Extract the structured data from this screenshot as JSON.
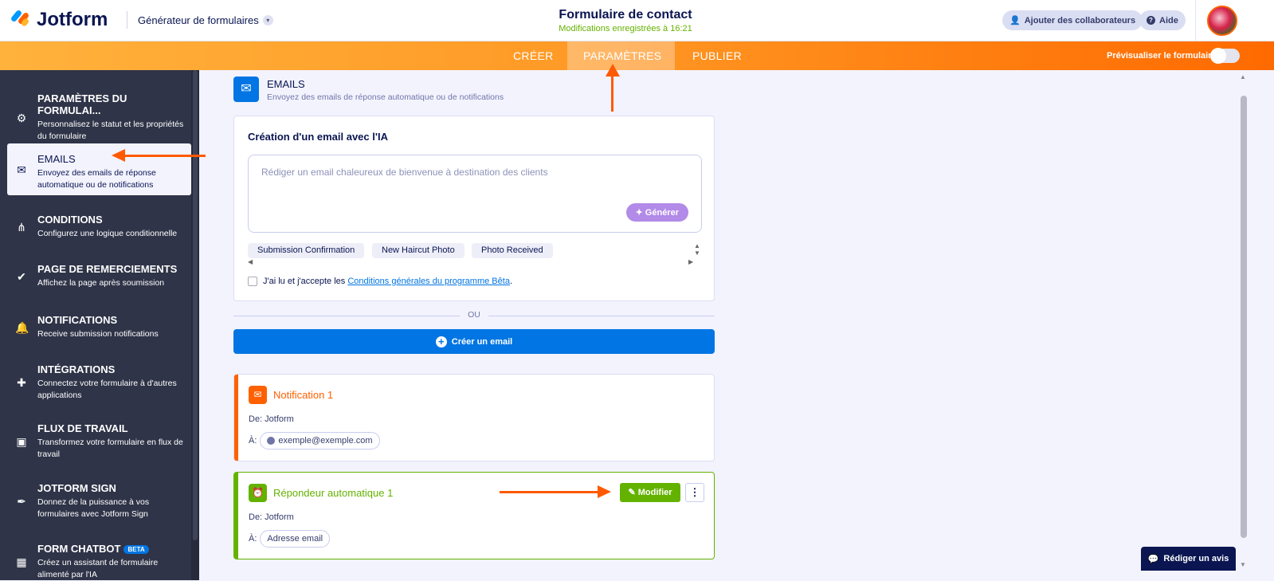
{
  "header": {
    "brand": "Jotform",
    "builder": "Générateur de formulaires",
    "form_title": "Formulaire de contact",
    "saved_status": "Modifications enregistrées à 16:21",
    "collab_label": "Ajouter des collaborateurs",
    "help_label": "Aide"
  },
  "nav": {
    "tabs": [
      {
        "label": "CRÉER"
      },
      {
        "label": "PARAMÈTRES"
      },
      {
        "label": "PUBLIER"
      }
    ],
    "preview_label": "Prévisualiser le formulaire",
    "preview_on": false
  },
  "sidebar": {
    "items": [
      {
        "title": "PARAMÈTRES DU FORMULAI...",
        "desc": "Personnalisez le statut et les propriétés du formulaire"
      },
      {
        "title": "EMAILS",
        "desc": "Envoyez des emails de réponse automatique ou de notifications"
      },
      {
        "title": "CONDITIONS",
        "desc": "Configurez une logique conditionnelle"
      },
      {
        "title": "PAGE DE REMERCIEMENTS",
        "desc": "Affichez la page après soumission"
      },
      {
        "title": "NOTIFICATIONS",
        "desc": "Receive submission notifications"
      },
      {
        "title": "INTÉGRATIONS",
        "desc": "Connectez votre formulaire à d'autres applications"
      },
      {
        "title": "FLUX DE TRAVAIL",
        "desc": "Transformez votre formulaire en flux de travail"
      },
      {
        "title": "JOTFORM SIGN",
        "desc": "Donnez de la puissance à vos formulaires avec Jotform Sign"
      },
      {
        "title": "FORM CHATBOT",
        "badge": "BETA",
        "desc": "Créez un assistant de formulaire alimenté par l'IA"
      }
    ]
  },
  "section": {
    "title": "EMAILS",
    "desc": "Envoyez des emails de réponse automatique ou de notifications"
  },
  "ai": {
    "title": "Création d'un email avec l'IA",
    "placeholder": "Rédiger un email chaleureux de bienvenue à destination des clients",
    "generate": "Générer",
    "chips": [
      "Submission Confirmation",
      "New Haircut Photo",
      "Photo Received"
    ],
    "terms_prefix": "J'ai lu et j'accepte les ",
    "terms_link": "Conditions générales du programme Bêta",
    "terms_suffix": "."
  },
  "or_label": "OU",
  "create_label": "Créer un email",
  "emails": [
    {
      "title": "Notification 1",
      "from": "De: Jotform",
      "to_label": "À:",
      "to": "exemple@exemple.com",
      "color": "#ff6100"
    },
    {
      "title": "Répondeur automatique 1",
      "from": "De: Jotform",
      "to_label": "À:",
      "to": "Adresse email",
      "color": "#64b200",
      "edit": "Modifier"
    }
  ],
  "review_label": "Rédiger un avis"
}
